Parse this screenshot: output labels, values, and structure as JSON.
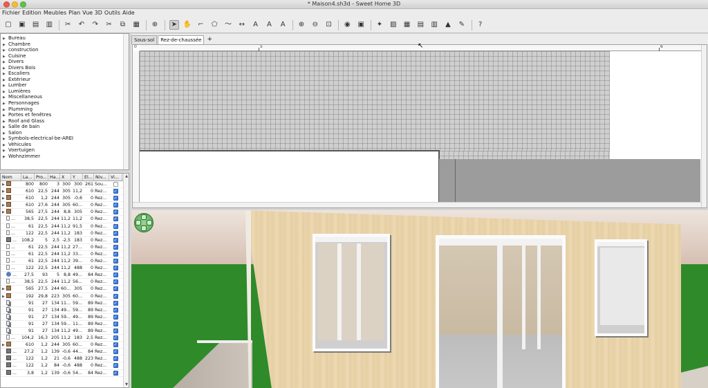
{
  "window": {
    "title": "* Maison4.sh3d - Sweet Home 3D"
  },
  "menu": [
    "Fichier",
    "Edition",
    "Meubles",
    "Plan",
    "Vue 3D",
    "Outils",
    "Aide"
  ],
  "toolbar": {
    "icons": [
      "new-home-icon",
      "new-from-template-icon",
      "open-icon",
      "save-icon",
      "cut-icon",
      "undo-icon",
      "redo-icon",
      "cut2-icon",
      "copy-icon",
      "paste-icon",
      "add-furniture-icon",
      "select-icon",
      "pan-icon",
      "create-walls-icon",
      "create-rooms-icon",
      "create-polylines-icon",
      "create-dimensions-icon",
      "create-labels-icon",
      "text-bold-icon",
      "text-italic-icon",
      "zoom-in-icon",
      "zoom-out-icon",
      "zoom-fit-icon",
      "create-photo-icon",
      "create-video-icon",
      "import-furniture-icon",
      "import-texture-icon",
      "modify-furniture-icon",
      "group-icon",
      "ungroup-icon",
      "modify-compass-icon",
      "preferences-icon",
      "help-icon"
    ]
  },
  "catalog": {
    "categories": [
      "Bureau",
      "Chambre",
      "construction",
      "Cuisine",
      "Divers",
      "Divers Bois",
      "Escaliers",
      "Extérieur",
      "Lumber",
      "Lumières",
      "Miscellaneous",
      "Personnages",
      "Plumming",
      "Portes et fenêtres",
      "Roof and Glass",
      "Salle de bain",
      "Salon",
      "Symbols-electrical-be-AREI",
      "Véhicules",
      "Voertuigen",
      "Wohnzimmer"
    ]
  },
  "furniture": {
    "headers": [
      "Nom",
      "La...",
      "Pro...",
      "Ha...",
      "X",
      "Y",
      "El...",
      "Niv...",
      "Vi..."
    ],
    "rows": [
      {
        "icon": "furn",
        "expand": true,
        "name": "",
        "la": "800",
        "pr": "800",
        "ha": "3",
        "x": "300",
        "y": "300",
        "el": "261",
        "ni": "Sou...",
        "vi": false
      },
      {
        "icon": "furn",
        "expand": true,
        "name": "",
        "la": "610",
        "pr": "22,5",
        "ha": "244",
        "x": "305",
        "y": "11,2",
        "el": "0",
        "ni": "Rez...",
        "vi": true
      },
      {
        "icon": "furn",
        "expand": true,
        "name": "",
        "la": "610",
        "pr": "1,2",
        "ha": "244",
        "x": "305",
        "y": "-0,6",
        "el": "0",
        "ni": "Rez...",
        "vi": true
      },
      {
        "icon": "furn",
        "expand": true,
        "name": "",
        "la": "610",
        "pr": "27,6",
        "ha": "244",
        "x": "305",
        "y": "60...",
        "el": "0",
        "ni": "Rez...",
        "vi": true
      },
      {
        "icon": "furn",
        "expand": true,
        "name": "",
        "la": "565",
        "pr": "27,5",
        "ha": "244",
        "x": "8,8",
        "y": "305",
        "el": "0",
        "ni": "Rez...",
        "vi": true
      },
      {
        "icon": "door",
        "expand": false,
        "name": "...",
        "la": "38,5",
        "pr": "22,5",
        "ha": "244",
        "x": "11,2",
        "y": "11,2",
        "el": "0",
        "ni": "Rez...",
        "vi": true
      },
      {
        "icon": "door",
        "expand": false,
        "name": "...",
        "la": "61",
        "pr": "22,5",
        "ha": "244",
        "x": "11,2",
        "y": "91,5",
        "el": "0",
        "ni": "Rez...",
        "vi": true
      },
      {
        "icon": "door",
        "expand": false,
        "name": "...",
        "la": "122",
        "pr": "22,5",
        "ha": "244",
        "x": "11,2",
        "y": "183",
        "el": "0",
        "ni": "Rez...",
        "vi": true
      },
      {
        "icon": "stair",
        "expand": false,
        "name": "...",
        "la": "108,2",
        "pr": "5",
        "ha": "2,5",
        "x": "-2,5",
        "y": "183",
        "el": "0",
        "ni": "Rez...",
        "vi": true
      },
      {
        "icon": "door",
        "expand": false,
        "name": "...",
        "la": "61",
        "pr": "22,5",
        "ha": "244",
        "x": "11,2",
        "y": "27...",
        "el": "0",
        "ni": "Rez...",
        "vi": true
      },
      {
        "icon": "door",
        "expand": false,
        "name": "...",
        "la": "61",
        "pr": "22,5",
        "ha": "244",
        "x": "11,2",
        "y": "33...",
        "el": "0",
        "ni": "Rez...",
        "vi": true
      },
      {
        "icon": "door",
        "expand": false,
        "name": "...",
        "la": "61",
        "pr": "22,5",
        "ha": "244",
        "x": "11,2",
        "y": "39...",
        "el": "0",
        "ni": "Rez...",
        "vi": true
      },
      {
        "icon": "door",
        "expand": false,
        "name": "...",
        "la": "122",
        "pr": "22,5",
        "ha": "244",
        "x": "11,2",
        "y": "488",
        "el": "0",
        "ni": "Rez...",
        "vi": true
      },
      {
        "icon": "misc",
        "expand": false,
        "name": "...",
        "la": "27,5",
        "pr": "93",
        "ha": "5",
        "x": "8,8",
        "y": "49...",
        "el": "84",
        "ni": "Rez...",
        "vi": true
      },
      {
        "icon": "door",
        "expand": false,
        "name": "...",
        "la": "38,5",
        "pr": "22,5",
        "ha": "244",
        "x": "11,2",
        "y": "56...",
        "el": "0",
        "ni": "Rez...",
        "vi": true
      },
      {
        "icon": "furn",
        "expand": true,
        "name": "",
        "la": "565",
        "pr": "27,5",
        "ha": "244",
        "x": "60...",
        "y": "305",
        "el": "0",
        "ni": "Rez...",
        "vi": true
      },
      {
        "icon": "furn",
        "expand": true,
        "name": "",
        "la": "192",
        "pr": "29,8",
        "ha": "223",
        "x": "305",
        "y": "60...",
        "el": "0",
        "ni": "Rez...",
        "vi": true
      },
      {
        "icon": "win",
        "expand": false,
        "name": "...",
        "la": "91",
        "pr": "27",
        "ha": "134",
        "x": "11...",
        "y": "59...",
        "el": "89",
        "ni": "Rez...",
        "vi": true
      },
      {
        "icon": "win",
        "expand": false,
        "name": "...",
        "la": "91",
        "pr": "27",
        "ha": "134",
        "x": "49...",
        "y": "59...",
        "el": "89",
        "ni": "Rez...",
        "vi": true
      },
      {
        "icon": "win",
        "expand": false,
        "name": "...",
        "la": "91",
        "pr": "27",
        "ha": "134",
        "x": "59...",
        "y": "49...",
        "el": "89",
        "ni": "Rez...",
        "vi": true
      },
      {
        "icon": "win",
        "expand": false,
        "name": "...",
        "la": "91",
        "pr": "27",
        "ha": "134",
        "x": "59...",
        "y": "11...",
        "el": "89",
        "ni": "Rez...",
        "vi": true
      },
      {
        "icon": "win",
        "expand": false,
        "name": "...",
        "la": "91",
        "pr": "27",
        "ha": "134",
        "x": "11,2",
        "y": "49...",
        "el": "89",
        "ni": "Rez...",
        "vi": true
      },
      {
        "icon": "door",
        "expand": false,
        "name": "...",
        "la": "104,2",
        "pr": "16,3",
        "ha": "205",
        "x": "11,2",
        "y": "183",
        "el": "2,5",
        "ni": "Rez...",
        "vi": true
      },
      {
        "icon": "furn",
        "expand": true,
        "name": "",
        "la": "610",
        "pr": "1,2",
        "ha": "244",
        "x": "305",
        "y": "60...",
        "el": "0",
        "ni": "Rez...",
        "vi": true
      },
      {
        "icon": "stair",
        "expand": false,
        "name": "...",
        "la": "27,2",
        "pr": "1,2",
        "ha": "139",
        "x": "-0,6",
        "y": "44...",
        "el": "84",
        "ni": "Rez...",
        "vi": true
      },
      {
        "icon": "stair",
        "expand": false,
        "name": "...",
        "la": "122",
        "pr": "1,2",
        "ha": "21",
        "x": "-0,6",
        "y": "488",
        "el": "223",
        "ni": "Rez...",
        "vi": true
      },
      {
        "icon": "stair",
        "expand": false,
        "name": "...",
        "la": "122",
        "pr": "1,2",
        "ha": "84",
        "x": "-0,6",
        "y": "488",
        "el": "0",
        "ni": "Rez...",
        "vi": true
      },
      {
        "icon": "stair",
        "expand": false,
        "name": "...",
        "la": "3,8",
        "pr": "1,2",
        "ha": "139",
        "x": "-0,6",
        "y": "54...",
        "el": "84",
        "ni": "Rez...",
        "vi": true
      }
    ]
  },
  "plan": {
    "tabs": [
      {
        "label": "Sous-sol",
        "active": false
      },
      {
        "label": "Rez-de-chaussée",
        "active": true
      }
    ],
    "add_tab": "+",
    "ruler": {
      "labels": [
        "0",
        "5",
        "6"
      ]
    }
  },
  "colors": {
    "accent": "#3e7ad8",
    "grass": "#2f8a2a",
    "wall": "#ead5ad"
  }
}
